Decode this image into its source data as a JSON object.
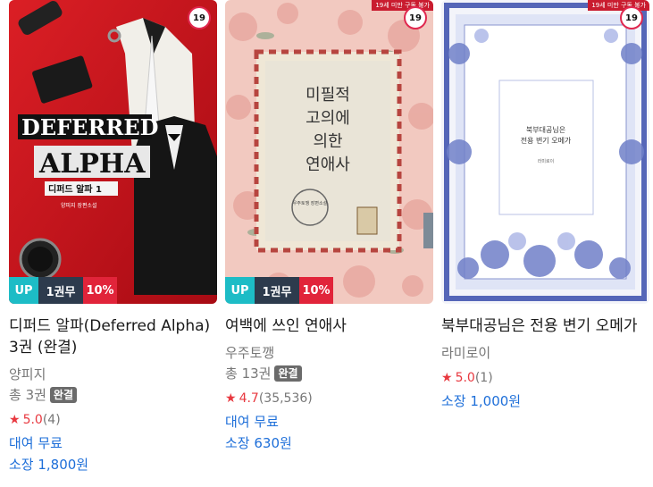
{
  "books": [
    {
      "title": "디퍼드 알파(Deferred Alpha) 3권 (완결)",
      "author": "양피지",
      "total": "총 3권",
      "completed": "완결",
      "rating": "5.0",
      "reviews": "(4)",
      "rent": "대여 무료",
      "buy": "소장 1,800원",
      "age": "19",
      "badges": {
        "up": "UP",
        "free": "1권무",
        "discount": "10%"
      },
      "cover_text": {
        "line1": "DEFERRED",
        "line2": "ALPHA",
        "sub": "디퍼드 알파 1",
        "credit": "양피지 장편소설"
      }
    },
    {
      "title": "여백에 쓰인 연애사",
      "author": "우주토깽",
      "total": "총 13권",
      "completed": "완결",
      "rating": "4.7",
      "reviews": "(35,536)",
      "rent": "대여 무료",
      "buy": "소장 630원",
      "age": "19",
      "age_ribbon": "19세 미만 구독 불가",
      "badges": {
        "up": "UP",
        "free": "1권무",
        "discount": "10%"
      },
      "cover_text": {
        "line1": "미필적",
        "line2": "고의에",
        "line3": "의한",
        "line4": "연애사",
        "credit": "우주토깽 장편소설"
      }
    },
    {
      "title": "북부대공님은 전용 변기 오메가",
      "author": "라미로이",
      "rating": "5.0",
      "reviews": "(1)",
      "buy": "소장 1,000원",
      "age": "19",
      "age_ribbon": "19세 미만 구독 불가",
      "cover_text": {
        "line1": "북부대공님은",
        "line2": "전용 변기 오메가",
        "credit": "라미로이"
      }
    }
  ],
  "colors": {
    "accent_blue": "#1e6fd9",
    "star_red": "#e8383f",
    "badge_up": "#1dbcc6",
    "badge_free": "#2d3b4d",
    "badge_discount": "#e1243a",
    "age_red": "#e0284f"
  },
  "icons": {
    "star": "star-icon"
  }
}
